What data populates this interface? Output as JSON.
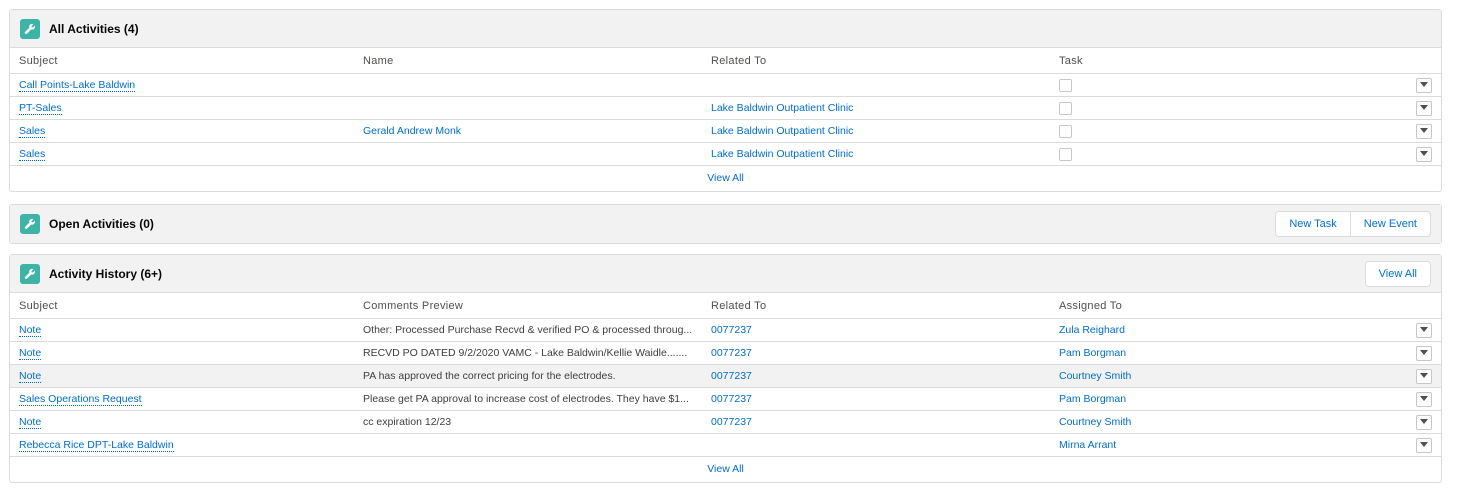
{
  "all_activities": {
    "title": "All Activities (4)",
    "columns": [
      "Subject",
      "Name",
      "Related To",
      "Task"
    ],
    "rows": [
      {
        "subject": "Call Points-Lake Baldwin",
        "name": "",
        "related": ""
      },
      {
        "subject": "PT-Sales",
        "name": "",
        "related": "Lake Baldwin Outpatient Clinic"
      },
      {
        "subject": "Sales",
        "name": "Gerald Andrew Monk",
        "related": "Lake Baldwin Outpatient Clinic"
      },
      {
        "subject": "Sales",
        "name": "",
        "related": "Lake Baldwin Outpatient Clinic"
      }
    ],
    "view_all": "View All"
  },
  "open_activities": {
    "title": "Open Activities (0)",
    "new_task": "New Task",
    "new_event": "New Event"
  },
  "activity_history": {
    "title": "Activity History (6+)",
    "header_view_all": "View All",
    "columns": [
      "Subject",
      "Comments Preview",
      "Related To",
      "Assigned To"
    ],
    "rows": [
      {
        "subject": "Note",
        "comments": "Other: Processed Purchase Recvd & verified PO & processed throug...",
        "related": "0077237",
        "assigned": "Zula Reighard"
      },
      {
        "subject": "Note",
        "comments": "RECVD PO DATED 9/2/2020 VAMC - Lake Baldwin/Kellie Waidle.......",
        "related": "0077237",
        "assigned": "Pam Borgman"
      },
      {
        "subject": "Note",
        "comments": "PA has approved the correct pricing for the electrodes.",
        "related": "0077237",
        "assigned": "Courtney Smith"
      },
      {
        "subject": "Sales Operations Request",
        "comments": "Please get PA approval to increase cost of electrodes. They have $1...",
        "related": "0077237",
        "assigned": "Pam Borgman"
      },
      {
        "subject": "Note",
        "comments": "cc expiration 12/23",
        "related": "0077237",
        "assigned": "Courtney Smith"
      },
      {
        "subject": "Rebecca Rice DPT-Lake Baldwin",
        "comments": "",
        "related": "",
        "assigned": "Mirna Arrant"
      }
    ],
    "view_all": "View All"
  },
  "colors": {
    "icon_bg": "#3eb4a7",
    "link": "#006dcc",
    "header_bg": "#f3f2f2",
    "border": "#dddbda"
  },
  "icons": {
    "card_icon": "wrench-icon",
    "row_menu": "chevron-down-icon"
  }
}
